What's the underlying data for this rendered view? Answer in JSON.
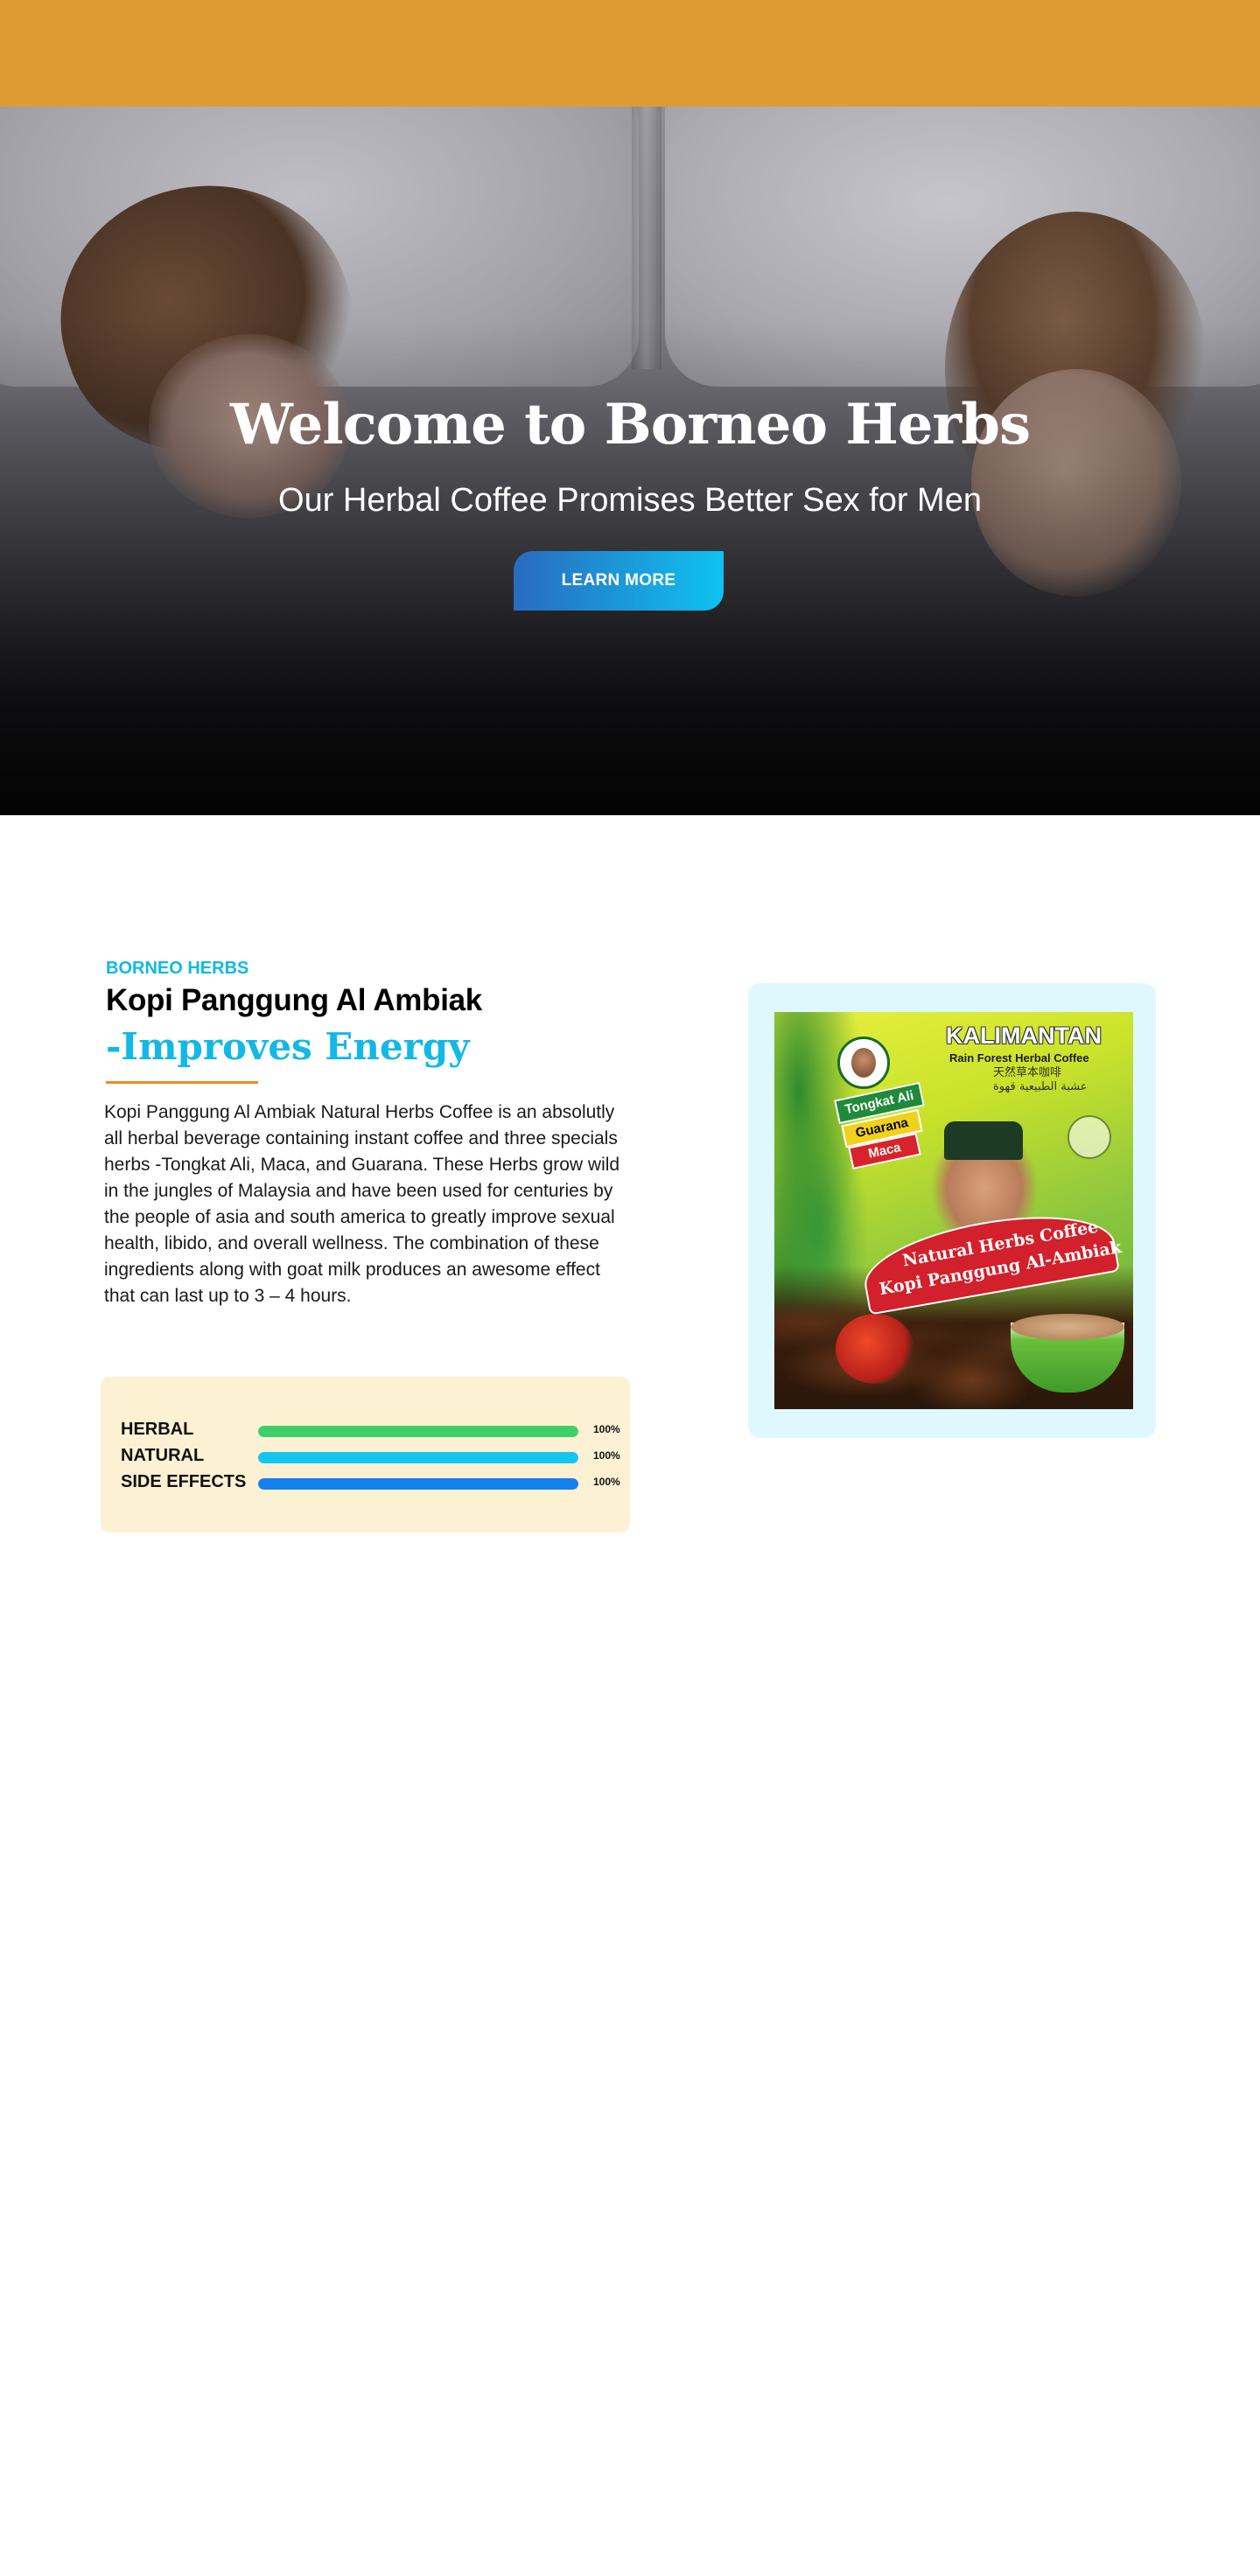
{
  "hero": {
    "title": "Welcome to Borneo Herbs",
    "subtitle": "Our Herbal Coffee Promises Better Sex for Men",
    "cta_label": "LEARN MORE"
  },
  "product": {
    "eyebrow": "BORNEO HERBS",
    "title": "Kopi Panggung Al Ambiak",
    "subtitle": "-Improves Energy",
    "description": "Kopi Panggung Al Ambiak Natural Herbs Coffee is an absolutly all herbal beverage containing instant coffee and three specials herbs -Tongkat Ali, Maca, and Guarana. These Herbs grow wild in the jungles of Malaysia and have been used for centuries by the people of asia and south america to greatly improve sexual health, libido, and overall wellness. The combination of these ingredients along with goat milk produces an awesome effect that can last up to 3 – 4 hours.",
    "skills": [
      {
        "label": "HERBAL",
        "percent_text": "100%",
        "value": 1.0,
        "color": "#3fd06a"
      },
      {
        "label": "NATURAL",
        "percent_text": "100%",
        "value": 1.0,
        "color": "#14c6ef"
      },
      {
        "label": "SIDE EFFECTS",
        "percent_text": "100%",
        "value": 1.0,
        "color": "#1380ee"
      }
    ]
  },
  "package": {
    "brand": "KALIMANTAN",
    "brand_sub": "Rain Forest Herbal Coffee",
    "script_lines": [
      "天然草本咖啡",
      "عشبة الطبيعية قهوة"
    ],
    "tags": [
      "Tongkat Ali",
      "Guarana",
      "Maca"
    ],
    "ribbon_line1": "Natural Herbs Coffee",
    "ribbon_line2": "Kopi Panggung Al-Ambiak"
  },
  "colors": {
    "topbar": "#df9b33",
    "accent": "#13b8e4",
    "underline": "#f08a24",
    "skills_panel": "#fdf1d4",
    "product_card": "#dff8fd"
  }
}
